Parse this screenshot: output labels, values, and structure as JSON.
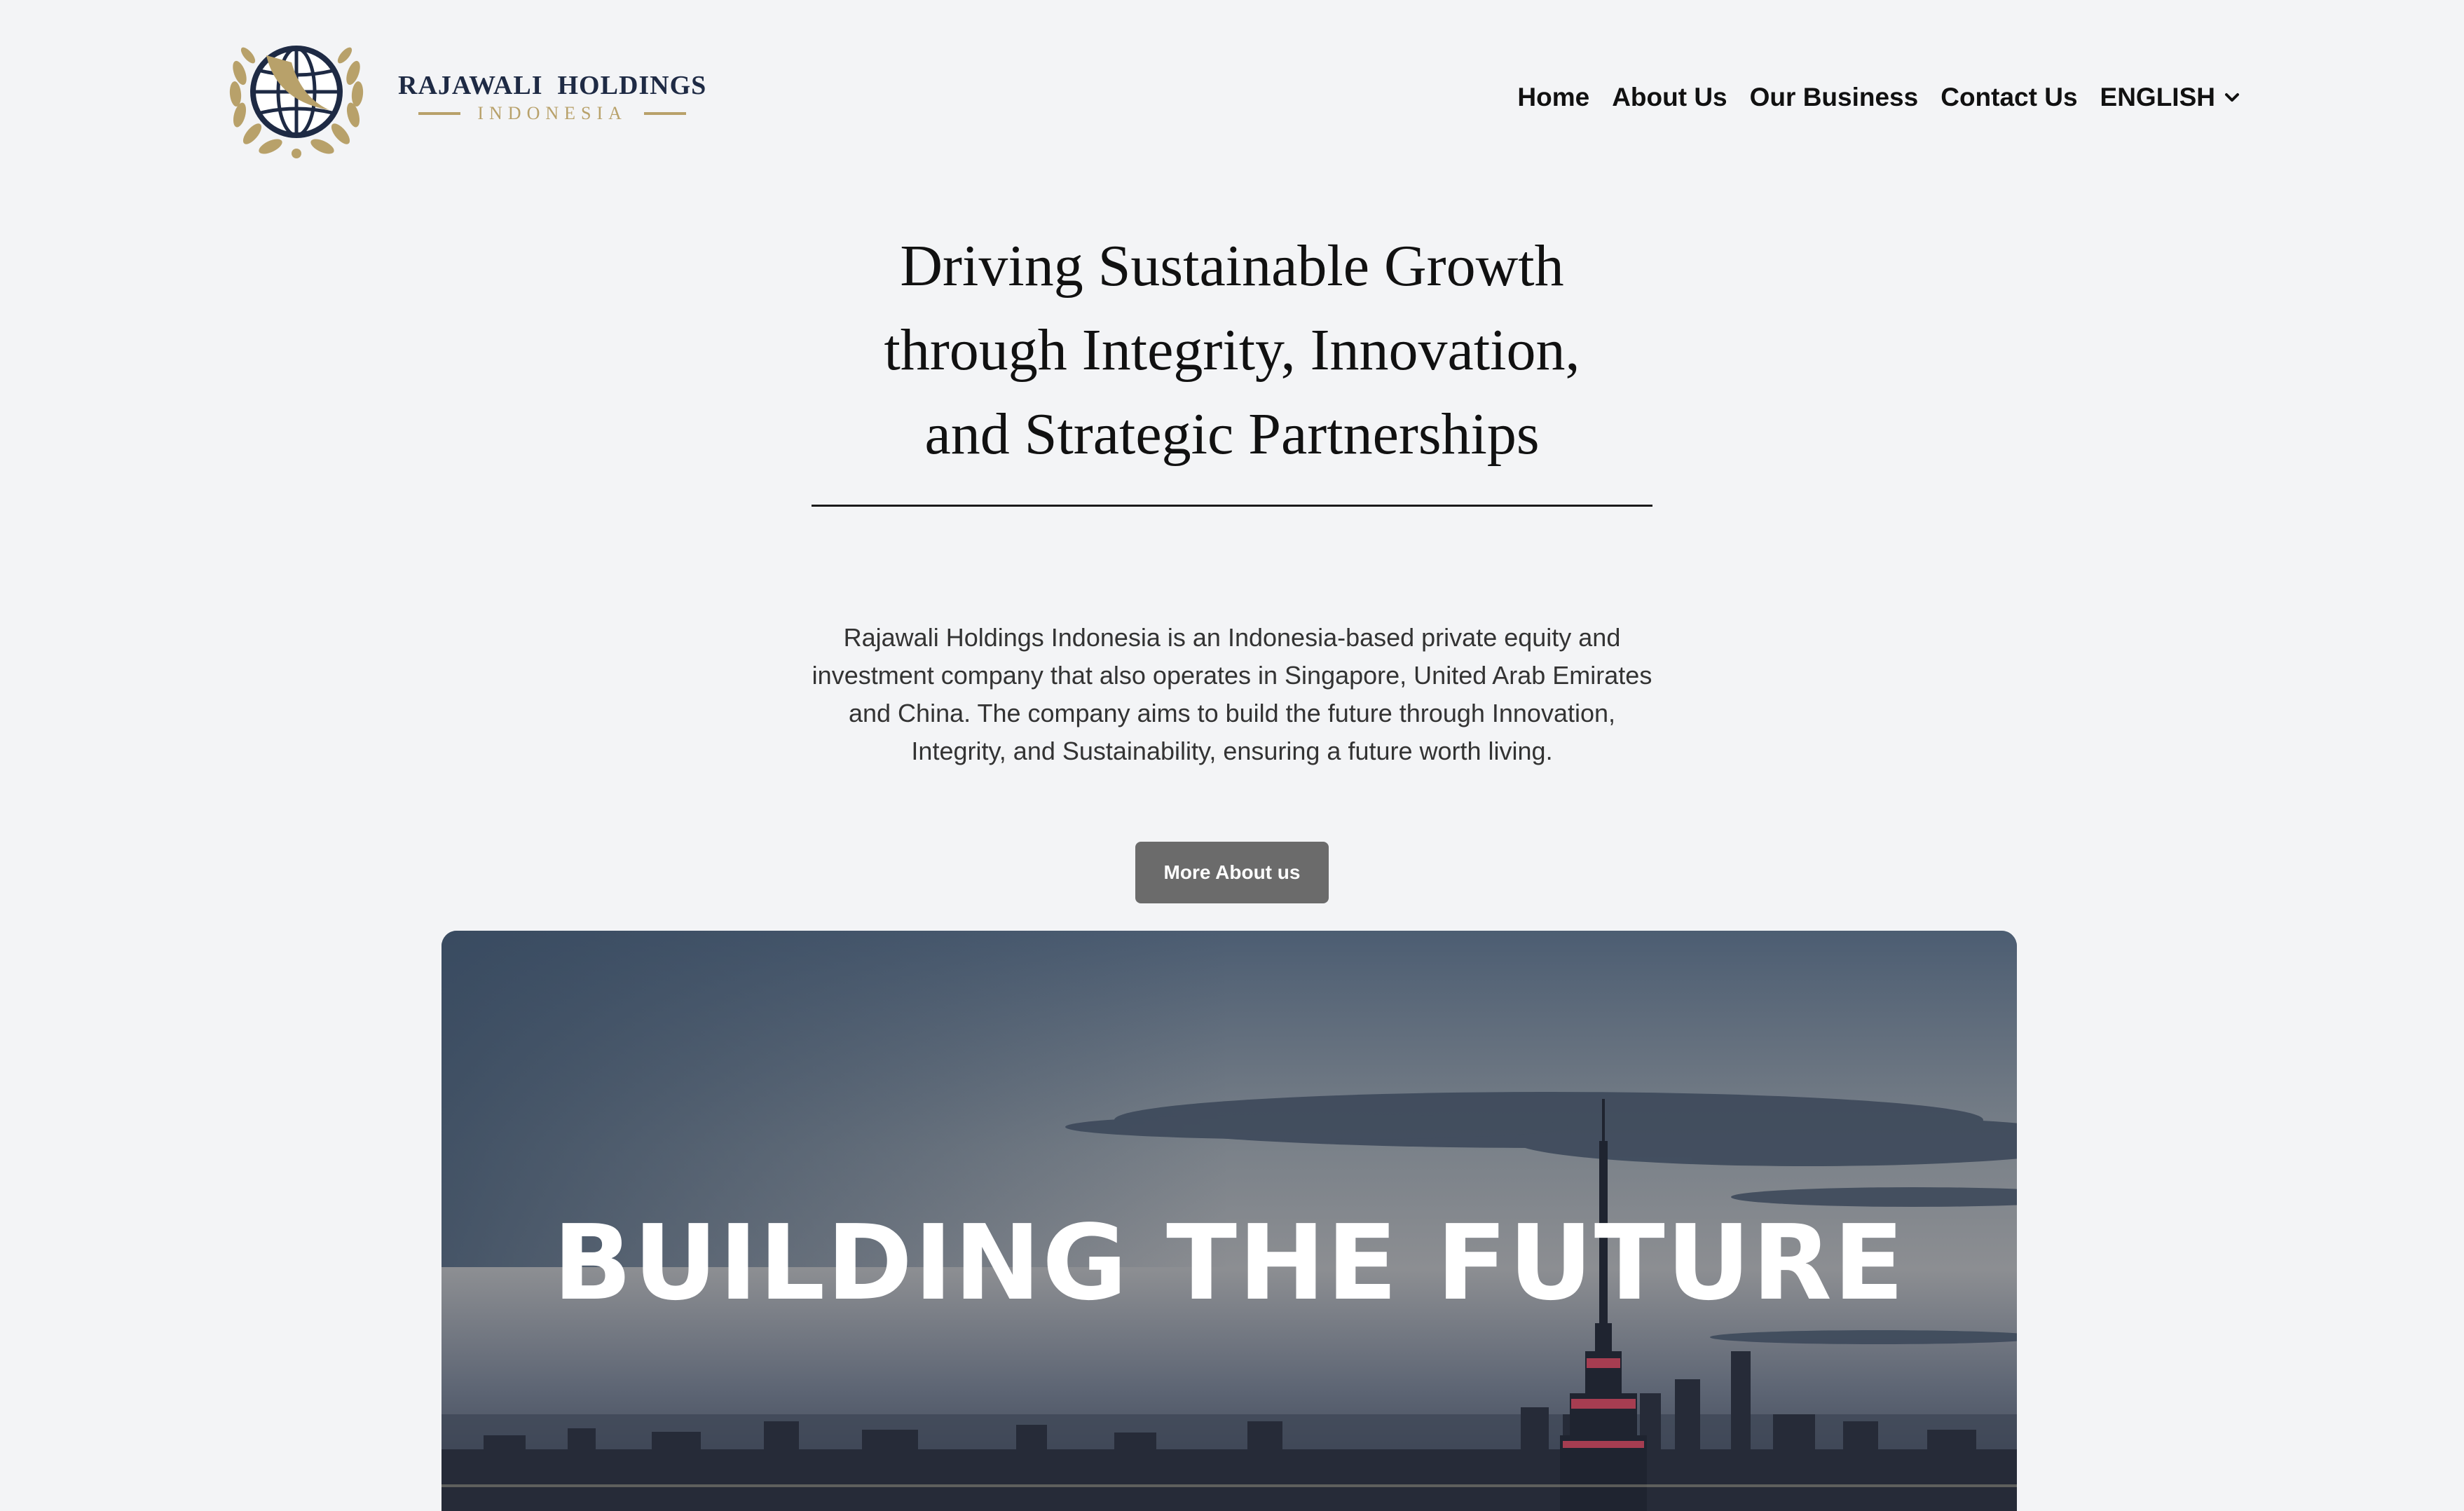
{
  "brand": {
    "name": "RAJAWALI  HOLDINGS",
    "subtitle": "INDONESIA",
    "colors": {
      "navy": "#1e2a44",
      "gold": "#b8a16a"
    },
    "icon": "globe-laurel-emblem"
  },
  "nav": {
    "items": [
      {
        "label": "Home"
      },
      {
        "label": "About Us"
      },
      {
        "label": "Our Business"
      },
      {
        "label": "Contact Us"
      }
    ],
    "language": {
      "label": "ENGLISH",
      "icon": "chevron-down-icon"
    }
  },
  "hero": {
    "headline_lines": [
      "Driving Sustainable Growth",
      "through Integrity, Innovation,",
      "and Strategic Partnerships"
    ],
    "intro_lines": [
      "Rajawali Holdings Indonesia is an Indonesia-based private equity and",
      "investment company that also operates in Singapore, United Arab Emirates",
      "and China. The company aims to build the future through Innovation,",
      "Integrity, and Sustainability, ensuring a future worth living."
    ],
    "cta_label": "More About us",
    "cta_color": "#6b6b6b"
  },
  "banner": {
    "title": "BUILDING THE FUTURE",
    "image": "city-skyline-dusk"
  }
}
